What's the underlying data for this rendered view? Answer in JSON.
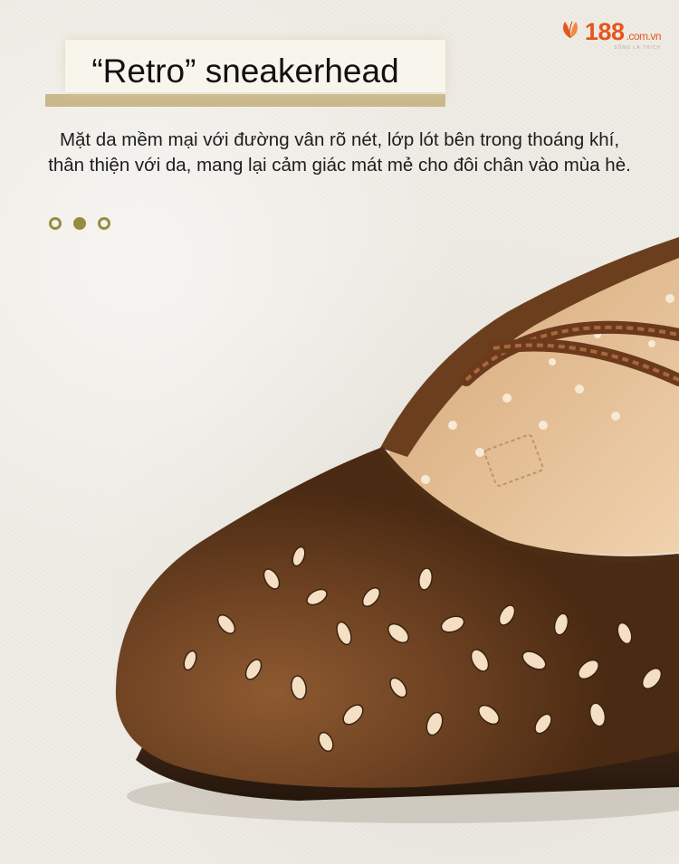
{
  "brand": {
    "name": "188",
    "domain": ".com.vn",
    "tagline": "SỐNG LÀ THÍCH",
    "color": "#e6561c"
  },
  "title": "“Retro” sneakerhead",
  "description": [
    "Mặt da mềm mại với đường vân rõ nét, lớp lót bên trong thoáng khí,",
    "thân thiện với da, mang lại cảm giác mát mẻ cho đôi chân vào mùa hè."
  ],
  "carousel": {
    "count": 3,
    "active_index": 2
  },
  "colors": {
    "accent": "#9a8b3c",
    "leather": "#7a4a28",
    "background": "#efece5"
  }
}
